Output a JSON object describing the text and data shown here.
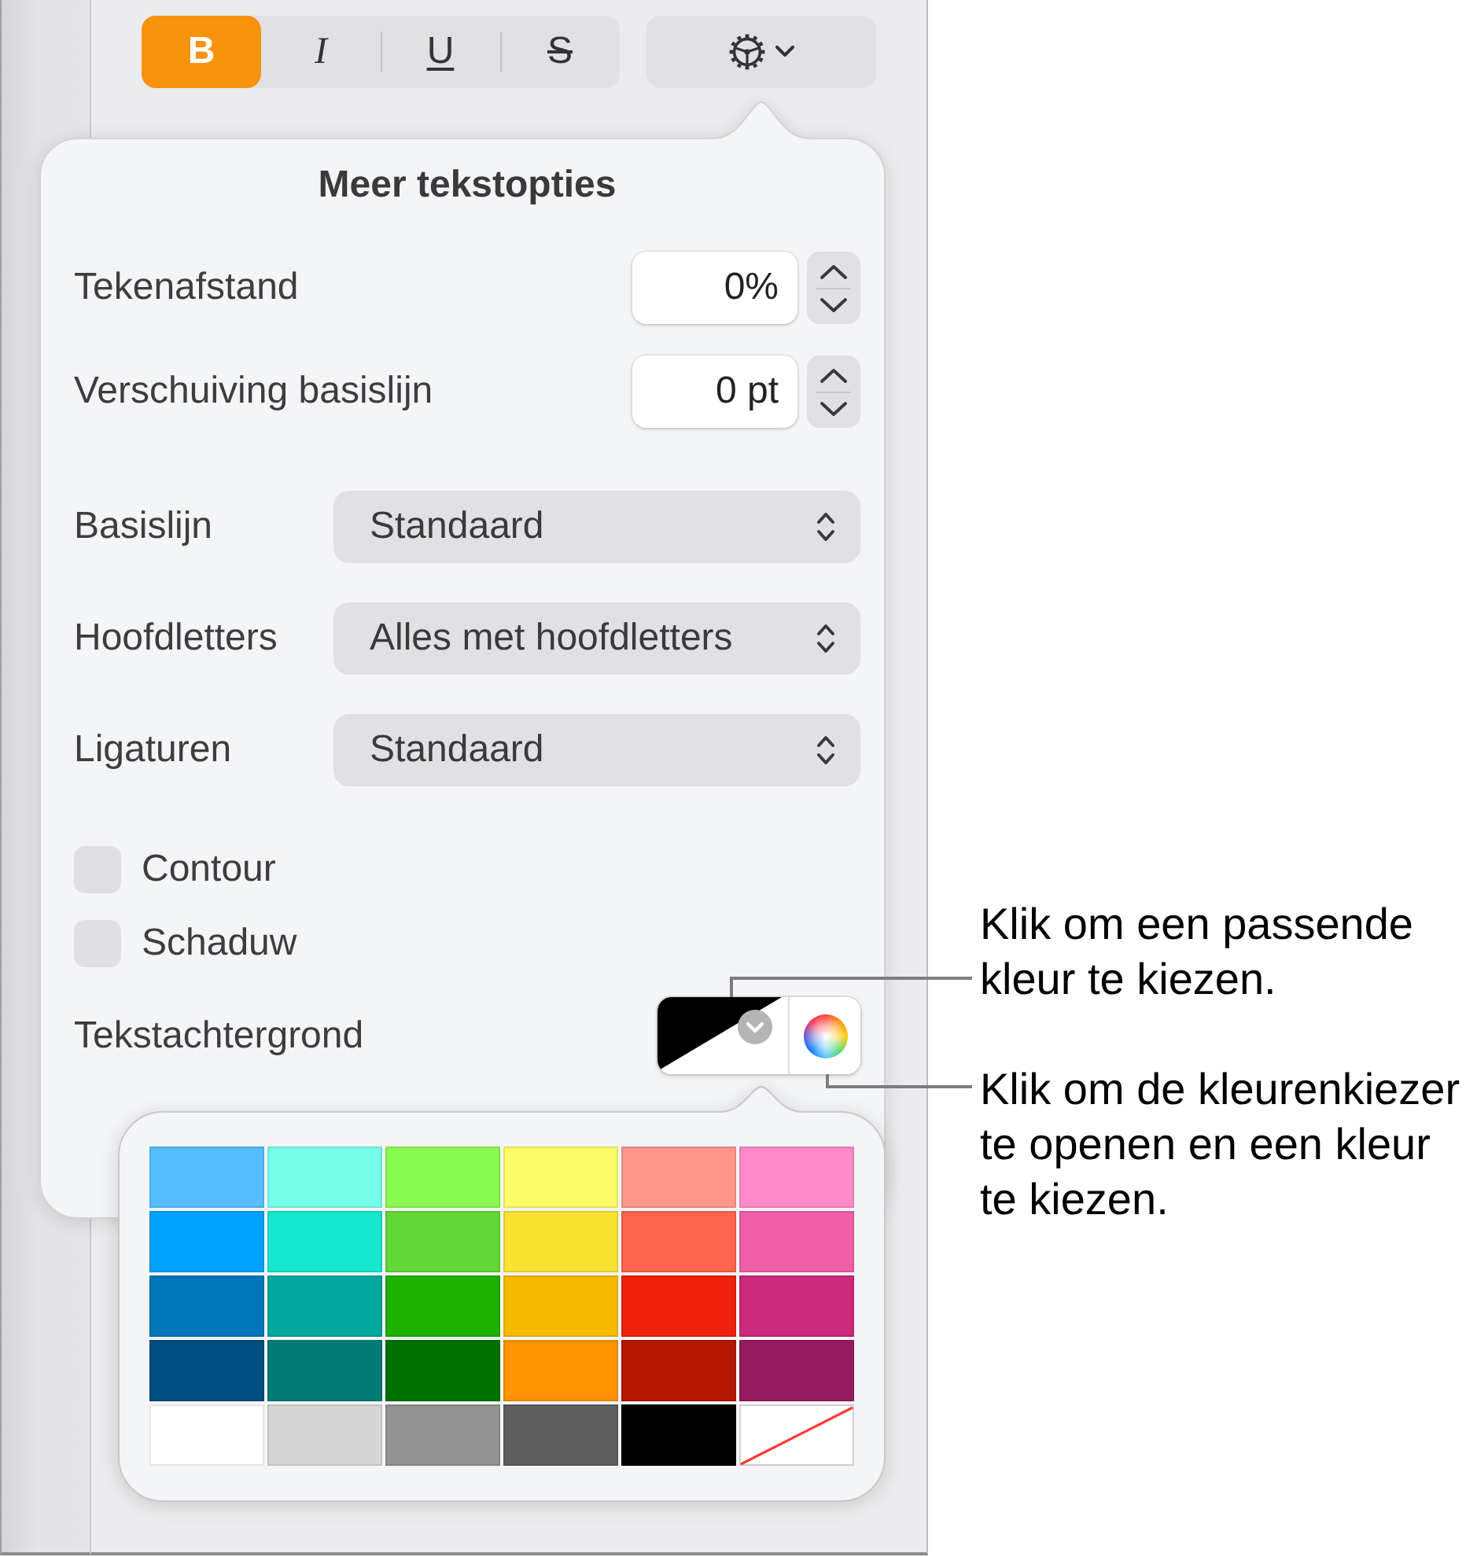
{
  "toolbar": {
    "style_buttons": [
      {
        "label": "B",
        "kind": "bold",
        "selected": true
      },
      {
        "label": "I",
        "kind": "italic",
        "selected": false
      },
      {
        "label": "U",
        "kind": "underline",
        "selected": false
      },
      {
        "label": "S",
        "kind": "strikethrough",
        "selected": false
      }
    ]
  },
  "text_options": {
    "title": "Meer tekstopties",
    "steppers": [
      {
        "label": "Tekenafstand",
        "value": "0%"
      },
      {
        "label": "Verschuiving basislijn",
        "value": "0 pt"
      }
    ],
    "dropdowns": [
      {
        "label": "Basislijn",
        "value": "Standaard"
      },
      {
        "label": "Hoofdletters",
        "value": "Alles met hoofdletters"
      },
      {
        "label": "Ligaturen",
        "value": "Standaard"
      }
    ],
    "checkboxes": [
      {
        "label": "Contour",
        "checked": false
      },
      {
        "label": "Schaduw",
        "checked": false
      }
    ],
    "text_background": {
      "label": "Tekstachtergrond"
    }
  },
  "color_palette": {
    "rows": [
      {
        "swatches": [
          {
            "kind": "color",
            "color": "#56bdfe"
          },
          {
            "kind": "color",
            "color": "#76feea"
          },
          {
            "kind": "color",
            "color": "#8afb51"
          },
          {
            "kind": "color",
            "color": "#fefb6a"
          },
          {
            "kind": "color",
            "color": "#ff968b"
          },
          {
            "kind": "color",
            "color": "#ff8ac9"
          }
        ]
      },
      {
        "swatches": [
          {
            "kind": "color",
            "color": "#00a2ff"
          },
          {
            "kind": "color",
            "color": "#16e7cf"
          },
          {
            "kind": "color",
            "color": "#61d836"
          },
          {
            "kind": "color",
            "color": "#fae232"
          },
          {
            "kind": "color",
            "color": "#ff644e"
          },
          {
            "kind": "color",
            "color": "#ef5fa7"
          }
        ]
      },
      {
        "swatches": [
          {
            "kind": "color",
            "color": "#0076ba"
          },
          {
            "kind": "color",
            "color": "#00a89d"
          },
          {
            "kind": "color",
            "color": "#1db100"
          },
          {
            "kind": "color",
            "color": "#f8ba00"
          },
          {
            "kind": "color",
            "color": "#ee220c"
          },
          {
            "kind": "color",
            "color": "#cb297b"
          }
        ]
      },
      {
        "swatches": [
          {
            "kind": "color",
            "color": "#004d80"
          },
          {
            "kind": "color",
            "color": "#017b76"
          },
          {
            "kind": "color",
            "color": "#017100"
          },
          {
            "kind": "color",
            "color": "#ff9300"
          },
          {
            "kind": "color",
            "color": "#b51700"
          },
          {
            "kind": "color",
            "color": "#961a60"
          }
        ]
      },
      {
        "swatches": [
          {
            "kind": "color",
            "color": "#ffffff"
          },
          {
            "kind": "color",
            "color": "#d6d6d6"
          },
          {
            "kind": "color",
            "color": "#929292"
          },
          {
            "kind": "color",
            "color": "#5e5e5e"
          },
          {
            "kind": "color",
            "color": "#000000"
          },
          {
            "kind": "none"
          }
        ]
      }
    ]
  },
  "callouts": [
    {
      "text": "Klik om een passende kleur te kiezen."
    },
    {
      "text": "Klik om de kleurenkiezer te openen en een kleur te kiezen."
    }
  ]
}
